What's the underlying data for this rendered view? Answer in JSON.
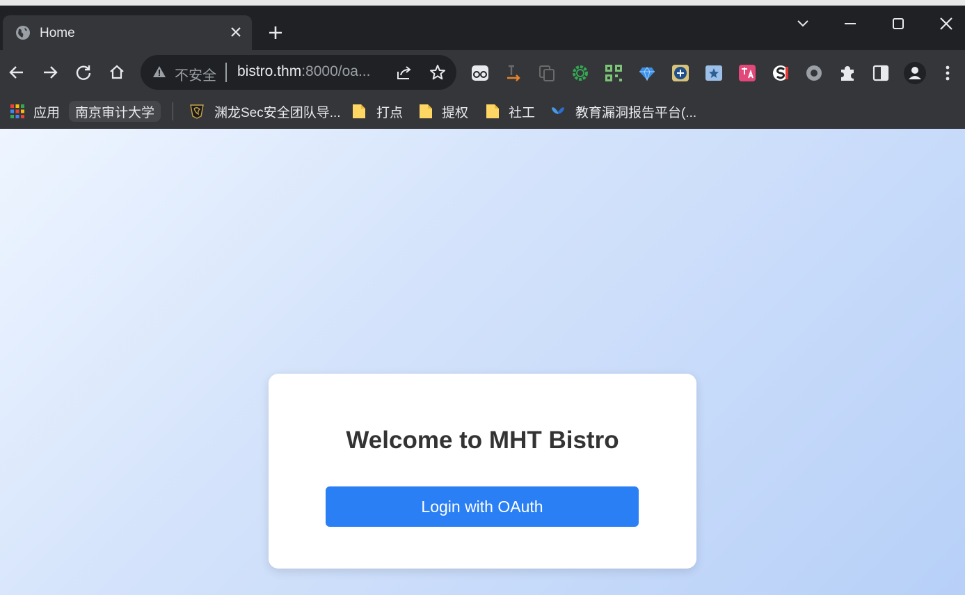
{
  "browser": {
    "tab": {
      "title": "Home",
      "favicon": "globe-icon"
    },
    "address_bar": {
      "security_label": "不安全",
      "url_host": "bistro.thm",
      "url_rest": ":8000/oa..."
    },
    "bookmarks": [
      {
        "label": "应用",
        "icon": "apps-grid-icon"
      },
      {
        "label": "南京审计大学",
        "icon": ""
      },
      {
        "label": "渊龙Sec安全团队导...",
        "icon": "dragon-logo-icon"
      },
      {
        "label": "打点",
        "icon": "folder-icon"
      },
      {
        "label": "提权",
        "icon": "folder-icon"
      },
      {
        "label": "社工",
        "icon": "folder-icon"
      },
      {
        "label": "教育漏洞报告平台(...",
        "icon": "butterfly-icon"
      }
    ]
  },
  "page": {
    "heading": "Welcome to MHT Bistro",
    "login_button": "Login with OAuth"
  },
  "colors": {
    "accent": "#2b7ff5",
    "chrome_dark": "#202124",
    "chrome_toolbar": "#35363a"
  }
}
